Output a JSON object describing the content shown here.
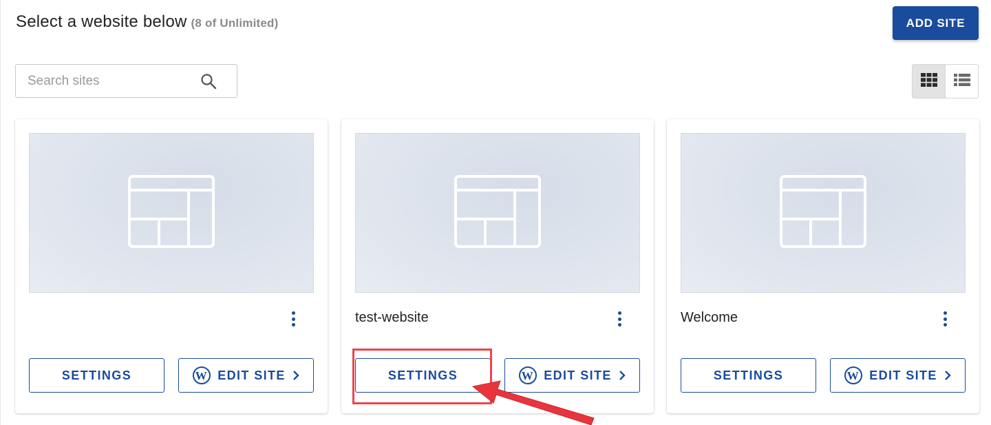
{
  "header": {
    "title": "Select a website below",
    "count": "(8 of Unlimited)",
    "add_site_label": "ADD SITE"
  },
  "search": {
    "placeholder": "Search sites",
    "value": ""
  },
  "view_toggle": {
    "options": [
      "grid-view",
      "list-view"
    ],
    "selected": "grid-view"
  },
  "cards": [
    {
      "name": "",
      "settings_label": "SETTINGS",
      "edit_label": "EDIT SITE"
    },
    {
      "name": "test-website",
      "settings_label": "SETTINGS",
      "edit_label": "EDIT SITE"
    },
    {
      "name": "Welcome",
      "settings_label": "SETTINGS",
      "edit_label": "EDIT SITE"
    }
  ],
  "colors": {
    "brand": "#1a4b9c",
    "annotation": "#f0434b"
  }
}
